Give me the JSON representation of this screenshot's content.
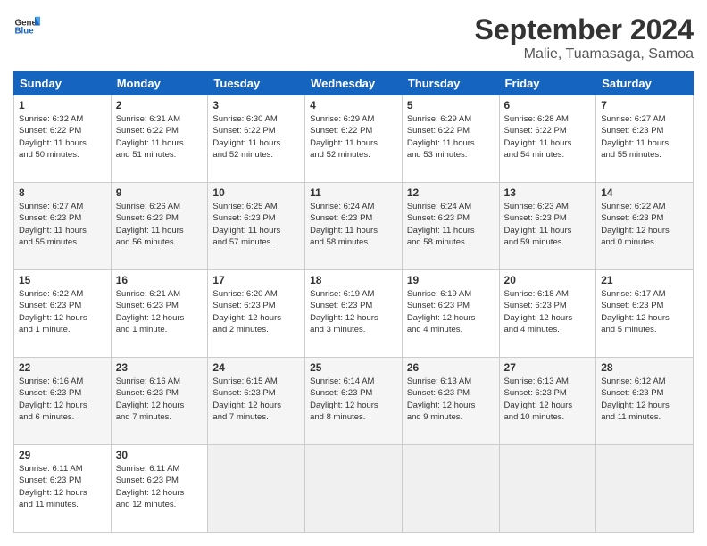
{
  "header": {
    "logo_general": "General",
    "logo_blue": "Blue",
    "month": "September 2024",
    "location": "Malie, Tuamasaga, Samoa"
  },
  "weekdays": [
    "Sunday",
    "Monday",
    "Tuesday",
    "Wednesday",
    "Thursday",
    "Friday",
    "Saturday"
  ],
  "weeks": [
    [
      {
        "day": "1",
        "info": "Sunrise: 6:32 AM\nSunset: 6:22 PM\nDaylight: 11 hours\nand 50 minutes."
      },
      {
        "day": "2",
        "info": "Sunrise: 6:31 AM\nSunset: 6:22 PM\nDaylight: 11 hours\nand 51 minutes."
      },
      {
        "day": "3",
        "info": "Sunrise: 6:30 AM\nSunset: 6:22 PM\nDaylight: 11 hours\nand 52 minutes."
      },
      {
        "day": "4",
        "info": "Sunrise: 6:29 AM\nSunset: 6:22 PM\nDaylight: 11 hours\nand 52 minutes."
      },
      {
        "day": "5",
        "info": "Sunrise: 6:29 AM\nSunset: 6:22 PM\nDaylight: 11 hours\nand 53 minutes."
      },
      {
        "day": "6",
        "info": "Sunrise: 6:28 AM\nSunset: 6:22 PM\nDaylight: 11 hours\nand 54 minutes."
      },
      {
        "day": "7",
        "info": "Sunrise: 6:27 AM\nSunset: 6:23 PM\nDaylight: 11 hours\nand 55 minutes."
      }
    ],
    [
      {
        "day": "8",
        "info": "Sunrise: 6:27 AM\nSunset: 6:23 PM\nDaylight: 11 hours\nand 55 minutes."
      },
      {
        "day": "9",
        "info": "Sunrise: 6:26 AM\nSunset: 6:23 PM\nDaylight: 11 hours\nand 56 minutes."
      },
      {
        "day": "10",
        "info": "Sunrise: 6:25 AM\nSunset: 6:23 PM\nDaylight: 11 hours\nand 57 minutes."
      },
      {
        "day": "11",
        "info": "Sunrise: 6:24 AM\nSunset: 6:23 PM\nDaylight: 11 hours\nand 58 minutes."
      },
      {
        "day": "12",
        "info": "Sunrise: 6:24 AM\nSunset: 6:23 PM\nDaylight: 11 hours\nand 58 minutes."
      },
      {
        "day": "13",
        "info": "Sunrise: 6:23 AM\nSunset: 6:23 PM\nDaylight: 11 hours\nand 59 minutes."
      },
      {
        "day": "14",
        "info": "Sunrise: 6:22 AM\nSunset: 6:23 PM\nDaylight: 12 hours\nand 0 minutes."
      }
    ],
    [
      {
        "day": "15",
        "info": "Sunrise: 6:22 AM\nSunset: 6:23 PM\nDaylight: 12 hours\nand 1 minute."
      },
      {
        "day": "16",
        "info": "Sunrise: 6:21 AM\nSunset: 6:23 PM\nDaylight: 12 hours\nand 1 minute."
      },
      {
        "day": "17",
        "info": "Sunrise: 6:20 AM\nSunset: 6:23 PM\nDaylight: 12 hours\nand 2 minutes."
      },
      {
        "day": "18",
        "info": "Sunrise: 6:19 AM\nSunset: 6:23 PM\nDaylight: 12 hours\nand 3 minutes."
      },
      {
        "day": "19",
        "info": "Sunrise: 6:19 AM\nSunset: 6:23 PM\nDaylight: 12 hours\nand 4 minutes."
      },
      {
        "day": "20",
        "info": "Sunrise: 6:18 AM\nSunset: 6:23 PM\nDaylight: 12 hours\nand 4 minutes."
      },
      {
        "day": "21",
        "info": "Sunrise: 6:17 AM\nSunset: 6:23 PM\nDaylight: 12 hours\nand 5 minutes."
      }
    ],
    [
      {
        "day": "22",
        "info": "Sunrise: 6:16 AM\nSunset: 6:23 PM\nDaylight: 12 hours\nand 6 minutes."
      },
      {
        "day": "23",
        "info": "Sunrise: 6:16 AM\nSunset: 6:23 PM\nDaylight: 12 hours\nand 7 minutes."
      },
      {
        "day": "24",
        "info": "Sunrise: 6:15 AM\nSunset: 6:23 PM\nDaylight: 12 hours\nand 7 minutes."
      },
      {
        "day": "25",
        "info": "Sunrise: 6:14 AM\nSunset: 6:23 PM\nDaylight: 12 hours\nand 8 minutes."
      },
      {
        "day": "26",
        "info": "Sunrise: 6:13 AM\nSunset: 6:23 PM\nDaylight: 12 hours\nand 9 minutes."
      },
      {
        "day": "27",
        "info": "Sunrise: 6:13 AM\nSunset: 6:23 PM\nDaylight: 12 hours\nand 10 minutes."
      },
      {
        "day": "28",
        "info": "Sunrise: 6:12 AM\nSunset: 6:23 PM\nDaylight: 12 hours\nand 11 minutes."
      }
    ],
    [
      {
        "day": "29",
        "info": "Sunrise: 6:11 AM\nSunset: 6:23 PM\nDaylight: 12 hours\nand 11 minutes."
      },
      {
        "day": "30",
        "info": "Sunrise: 6:11 AM\nSunset: 6:23 PM\nDaylight: 12 hours\nand 12 minutes."
      },
      null,
      null,
      null,
      null,
      null
    ]
  ]
}
